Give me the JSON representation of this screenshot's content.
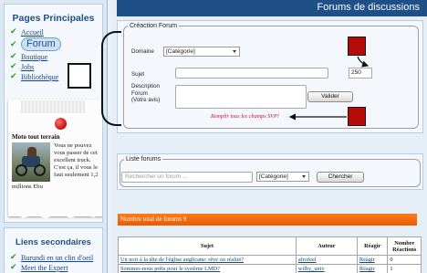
{
  "sidebar": {
    "main_title": "Pages Principales",
    "nav": [
      "Accueil",
      "Forum",
      "Boutique",
      "Jobs",
      "Bibliothèque"
    ],
    "note": {
      "title": "Moto tout terrain",
      "text": "Vous ne pouvez vous passer de cet excellent truck. C'est ça, il vous le faut seulement 1,2",
      "more": "millions Ebu"
    },
    "secondary_title": "Liens secondaires",
    "secondary_links": [
      "Burundi en un clin d'oeil",
      "Meet the Expert"
    ]
  },
  "header": {
    "title": "Forums de discussions"
  },
  "create_form": {
    "legend": "Créaction Forum",
    "domain_label": "Domaine",
    "domain_value": "[Catégorie]",
    "subject_label": "Sujet",
    "description_label": "Description Forum (Votre avis)",
    "char_counter": "250",
    "validate_button": "Valider",
    "warning": "Remplir tous les champs SVP!"
  },
  "list_form": {
    "legend": "Liste forums",
    "search_placeholder": "Rechercher un forum ...",
    "category_value": "[Catégorie]",
    "search_button": "Chercher"
  },
  "total_bar": "Nombre total de forums 9",
  "table": {
    "headers": [
      "Sujet",
      "Auteur",
      "Réagir",
      "Nombre Réactions"
    ],
    "rows": [
      [
        "Un noir à la tête de l'église anglicane: rêve ou réalité?",
        "afrofeel",
        "Réagir",
        "0"
      ],
      [
        "Sommes-nous prêts pour le système LMD?",
        "wilby_univ",
        "Réagir",
        "1"
      ]
    ]
  },
  "colors": {
    "accent": "#1e4f86",
    "header_bg": "#1e4f86",
    "total_bar": "#ff7a1a",
    "warning": "#c8102e",
    "annotation_red": "#b40a0a",
    "check": "#2e9a2a"
  },
  "icons": [
    "check-icon",
    "push-pin-icon",
    "dropdown-arrow-icon"
  ]
}
